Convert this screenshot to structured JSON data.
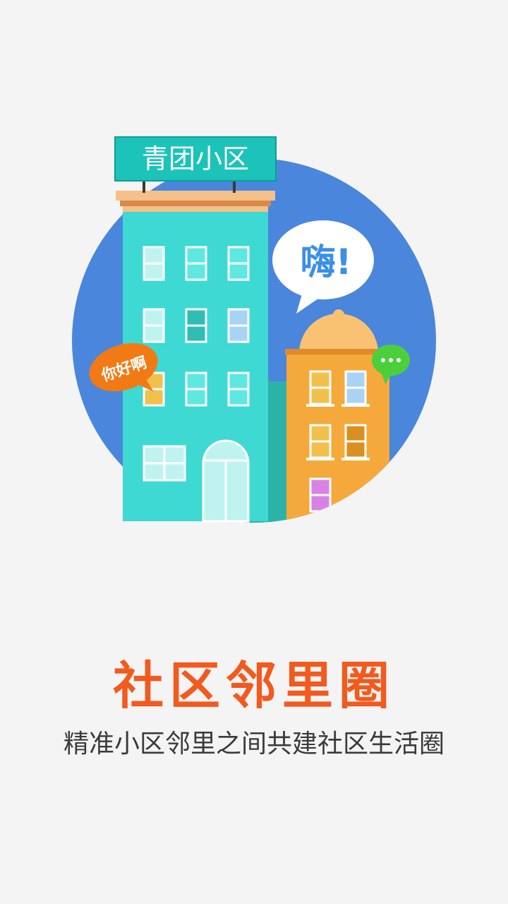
{
  "splash": {
    "illustration": {
      "sign_text": "青团小区",
      "speech_bubble_text": "嗨!",
      "greeting_bubble_text": "你好啊",
      "chat_bubble_dots": "•••"
    },
    "headline": "社区邻里圈",
    "tagline": "精准小区邻里之间共建社区生活圈"
  },
  "colors": {
    "background": "#f4f4f4",
    "circle": "#4a86dc",
    "building_teal": "#3ed9d2",
    "building_orange": "#f4a93a",
    "sign": "#1cc3b8",
    "headline": "#f25a1e",
    "tagline": "#3a3a3a"
  }
}
